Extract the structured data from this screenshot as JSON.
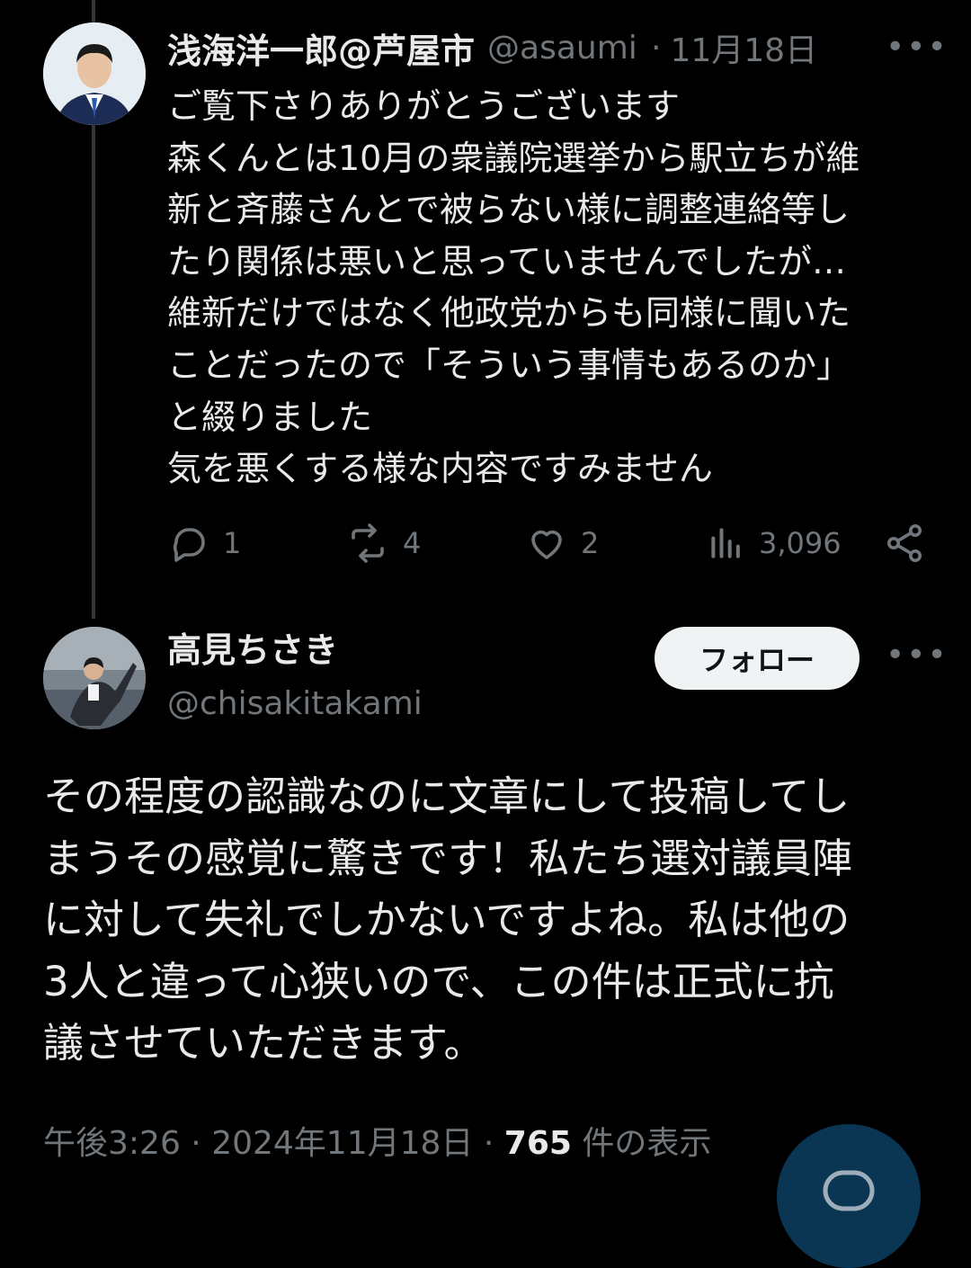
{
  "reply_tweet": {
    "author_name": "浅海洋一郎@芦屋市",
    "handle": "@asaumi",
    "separator": "·",
    "date": "11月18日",
    "more": "•••",
    "lines": [
      "ご覧下さりありがとうございます",
      "森くんとは10月の衆議院選挙から駅立ちが維",
      "新と斉藤さんとで被らない様に調整連絡等し",
      "たり関係は悪いと思っていませんでしたが…",
      "維新だけではなく他政党からも同様に聞いた",
      "ことだったので「そういう事情もあるのか」",
      "と綴りました",
      "気を悪くする様な内容ですみません"
    ],
    "stats": {
      "replies": "1",
      "reposts": "4",
      "likes": "2",
      "views": "3,096"
    },
    "icons": [
      "reply-icon",
      "repost-icon",
      "like-icon",
      "views-icon",
      "share-icon"
    ]
  },
  "main_tweet": {
    "author_name": "高見ちさき",
    "handle": "@chisakitakami",
    "follow_label": "フォロー",
    "more": "•••",
    "lines": [
      "その程度の認識なのに文章にして投稿してし",
      "まうその感覚に驚きです！私たち選対議員陣",
      "に対して失礼でしかないですよね。私は他の",
      "3人と違って心狭いので、この件は正式に抗",
      "議させていただきます。"
    ],
    "meta": {
      "time": "午後3:26",
      "sep1": " · ",
      "date": "2024年11月18日",
      "sep2": " · ",
      "views": "765",
      "views_suffix": " 件の表示"
    }
  },
  "colors": {
    "background": "#000000",
    "text": "#e7e9ea",
    "muted": "#71767b",
    "follow_bg": "#eff3f4",
    "accent": "#1d9bf0"
  }
}
